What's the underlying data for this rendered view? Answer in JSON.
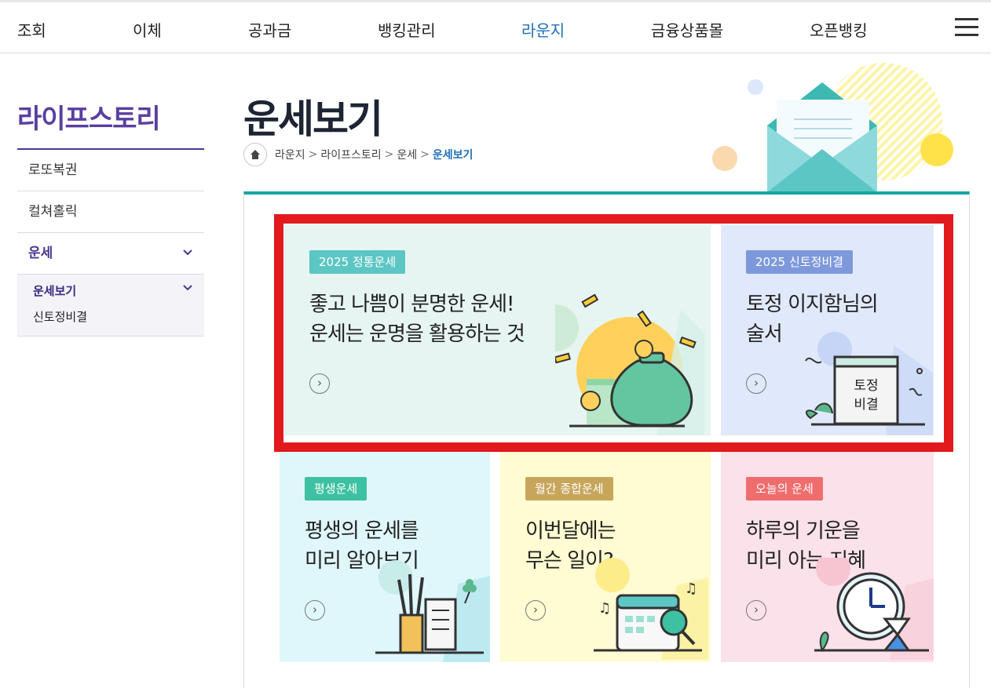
{
  "topnav": {
    "items": [
      "조회",
      "이체",
      "공과금",
      "뱅킹관리",
      "라운지",
      "금융상품몰",
      "오픈뱅킹"
    ],
    "active": "라운지",
    "active_color": "#1f6fb8"
  },
  "sidebar": {
    "title": "라이프스토리",
    "items": [
      {
        "label": "로또복권"
      },
      {
        "label": "컬쳐홀릭"
      },
      {
        "label": "운세"
      }
    ],
    "sub": {
      "current": "운세보기",
      "items": [
        "신토정비결"
      ]
    }
  },
  "page": {
    "title": "운세보기",
    "breadcrumb": [
      "라운지",
      "라이프스토리",
      "운세"
    ],
    "breadcrumb_current": "운세보기"
  },
  "cards": [
    {
      "badge": "2025 정통운세",
      "line1": "좋고 나쁨이 분명한 운세!",
      "line2": "운세는 운명을 활용하는 것",
      "badge_color": "#5cc6c4",
      "icon": "money-bag-icon"
    },
    {
      "badge": "2025 신토정비결",
      "line1": "토정 이지함님의",
      "line2": "술서",
      "badge_color": "#7d99dc",
      "icon": "book-icon",
      "book_text1": "토정",
      "book_text2": "비결"
    },
    {
      "badge": "평생운세",
      "line1": "평생의 운세를",
      "line2": "미리 알아보기",
      "badge_color": "#3ec1a2",
      "icon": "brush-cup-icon"
    },
    {
      "badge": "월간 종합운세",
      "line1": "이번달에는",
      "line2": "무슨 일이?",
      "badge_color": "#c7a65c",
      "icon": "calendar-icon"
    },
    {
      "badge": "오늘의 운세",
      "line1": "하루의 기운을",
      "line2": "미리 아는 지혜",
      "badge_color": "#ef6d6d",
      "icon": "clock-icon"
    }
  ],
  "colors": {
    "brand_purple": "#5a3fa0",
    "panel_top": "#17a5a3",
    "highlight_red": "#e2191d"
  }
}
